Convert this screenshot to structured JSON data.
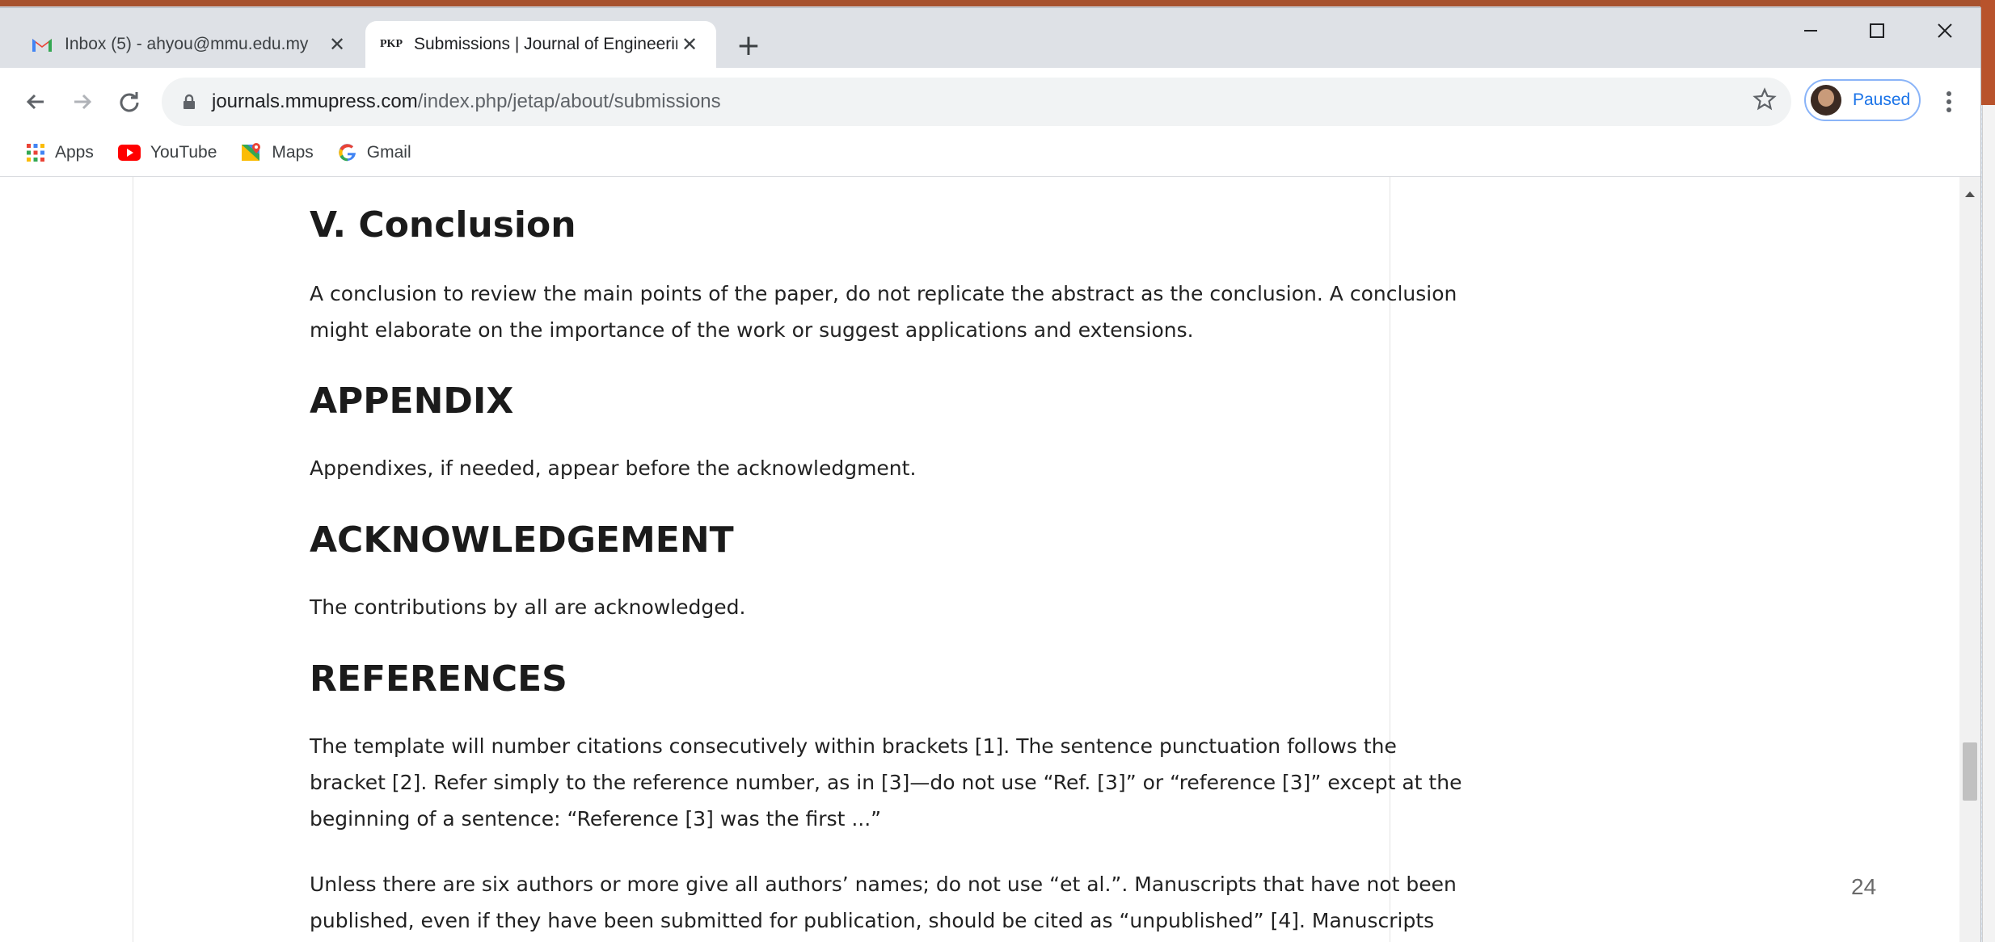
{
  "tabs": [
    {
      "title": "Inbox (5) - ahyou@mmu.edu.my",
      "icon": "gmail-icon"
    },
    {
      "title": "Submissions | Journal of Engineering",
      "icon": "pkp-icon",
      "icon_text": "PKP",
      "active": true
    }
  ],
  "address_bar": {
    "host": "journals.mmupress.com",
    "path": "/index.php/jetap/about/submissions"
  },
  "profile": {
    "status": "Paused"
  },
  "bookmarks": [
    {
      "label": "Apps",
      "icon": "apps-grid-icon"
    },
    {
      "label": "YouTube",
      "icon": "youtube-icon"
    },
    {
      "label": "Maps",
      "icon": "maps-icon"
    },
    {
      "label": "Gmail",
      "icon": "google-g-icon"
    }
  ],
  "article": {
    "conclusion_heading": "V. Conclusion",
    "conclusion_text": "A conclusion to review the main points of the paper, do not replicate the abstract as the conclusion. A conclusion might elaborate on the importance of the work or suggest applications and extensions.",
    "appendix_heading": "APPENDIX",
    "appendix_text": "Appendixes, if needed, appear before the acknowledgment.",
    "ack_heading": "ACKNOWLEDGEMENT",
    "ack_text": "The contributions by all are acknowledged.",
    "references_heading": "REFERENCES",
    "references_text_1": "The template will number citations consecutively within brackets [1]. The sentence punctuation follows the bracket [2]. Refer simply to the reference number, as in [3]—do not use “Ref. [3]” or “reference [3]” except at the beginning of a sentence: “Reference [3] was the first ...”",
    "references_text_2": "Unless there are six authors or more give all authors’ names; do not use “et al.”. Manuscripts that have not been published, even if they have been submitted for publication, should be cited as “unpublished” [4]. Manuscripts that have"
  },
  "slide": {
    "page_number": "24"
  },
  "colors": {
    "accent": "#1a73e8",
    "slide_brand": "#a7522e"
  }
}
